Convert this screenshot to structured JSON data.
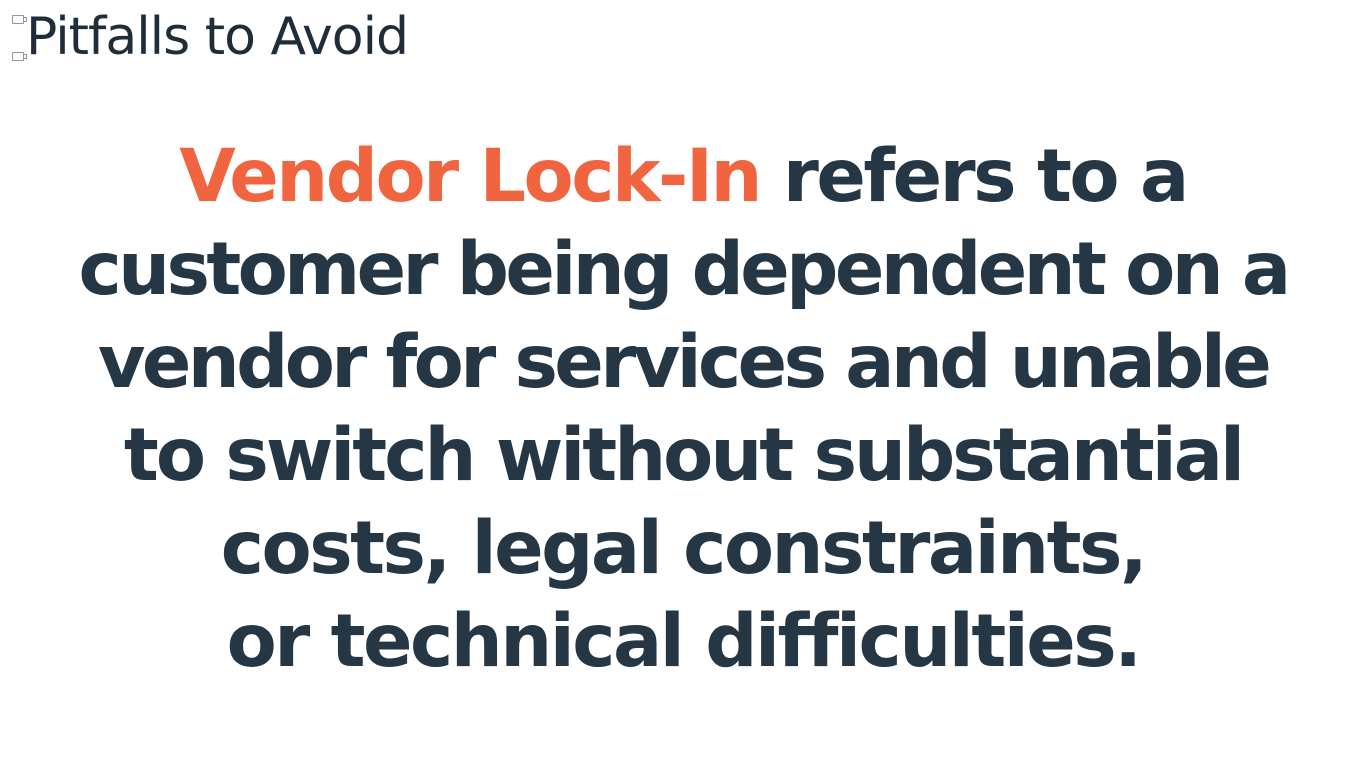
{
  "slide": {
    "title": "Pitfalls to Avoid",
    "definition": {
      "term": "Vendor Lock-In",
      "line_1_rest": " refers to a",
      "line_2": "customer being dependent on a",
      "line_3": "vendor for services and unable",
      "line_4": "to switch without substantial",
      "line_5": "costs, legal constraints,",
      "line_6": "or technical difficulties."
    }
  },
  "colors": {
    "text": "#253645",
    "highlight": "#f0643f",
    "background": "#ffffff"
  }
}
